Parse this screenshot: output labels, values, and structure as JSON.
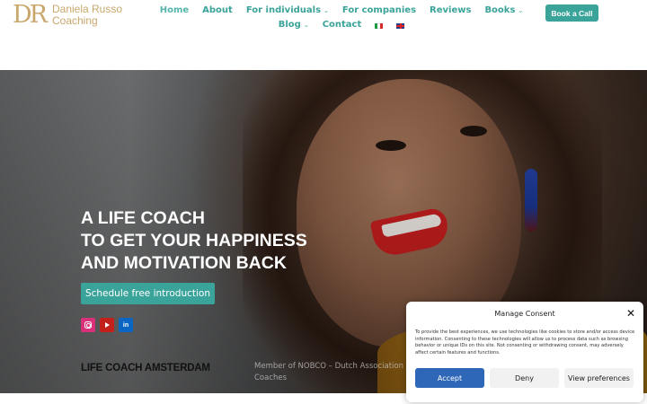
{
  "brand": {
    "monogram": "DR",
    "name_line1": "Daniela Russo",
    "name_line2": "Coaching",
    "color": "#c9a76a"
  },
  "nav": {
    "items": [
      {
        "label": "Home",
        "active": true
      },
      {
        "label": "About"
      },
      {
        "label": "For individuals",
        "dropdown": true
      },
      {
        "label": "For companies"
      },
      {
        "label": "Reviews"
      },
      {
        "label": "Books",
        "dropdown": true
      },
      {
        "label": "Blog",
        "dropdown": true
      },
      {
        "label": "Contact"
      }
    ],
    "languages": [
      "it-flag-icon",
      "uk-flag-icon"
    ],
    "cta_label": "Book a Call",
    "accent_color": "#3aa39a"
  },
  "hero": {
    "title_lines": [
      "A LIFE COACH",
      "TO GET YOUR HAPPINESS",
      "AND MOTIVATION BACK"
    ],
    "cta_label": "Schedule free introduction",
    "socials": [
      "instagram-icon",
      "youtube-icon",
      "linkedin-icon"
    ],
    "footer_left": "LIFE COACH AMSTERDAM",
    "footer_mid": "Member of NOBCO – Dutch Association of Coaches"
  },
  "consent": {
    "title": "Manage Consent",
    "body": "To provide the best experiences, we use technologies like cookies to store and/or access device information. Consenting to these technologies will allow us to process data such as browsing behavior or unique IDs on this site. Not consenting or withdrawing consent, may adversely affect certain features and functions.",
    "accept_label": "Accept",
    "deny_label": "Deny",
    "prefs_label": "View preferences",
    "accept_color": "#2f67b8"
  }
}
